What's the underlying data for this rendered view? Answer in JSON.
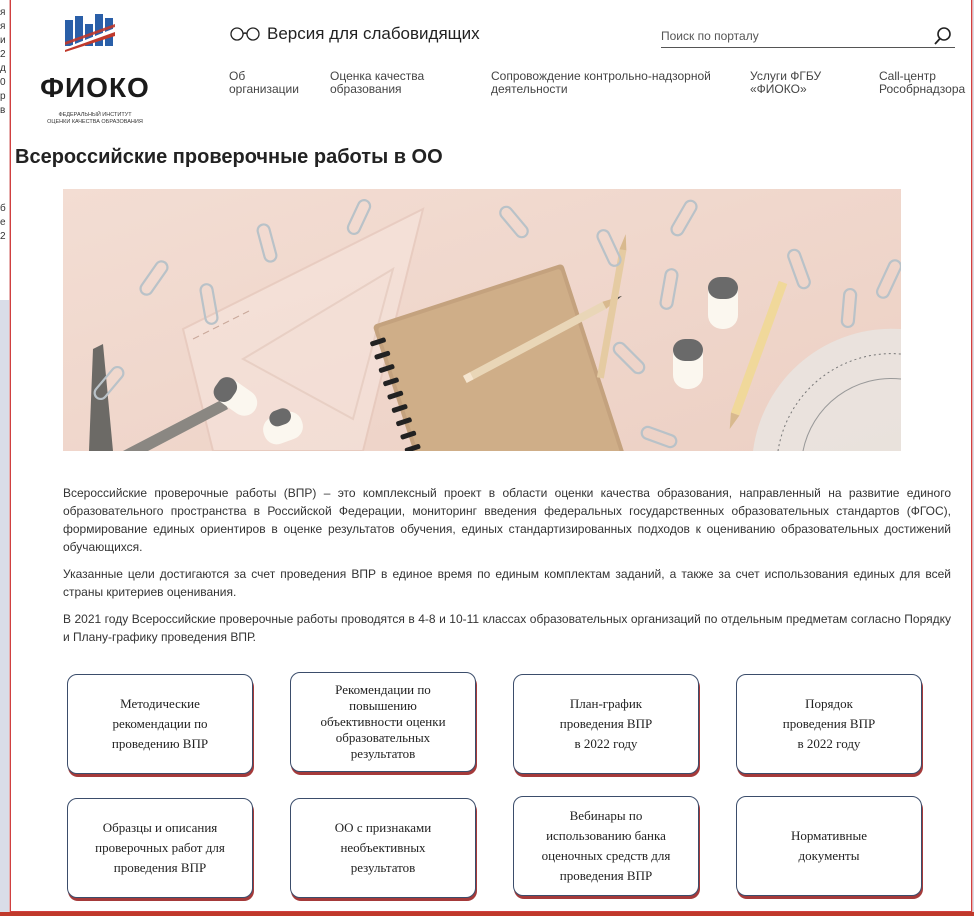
{
  "left_edge_chars": [
    "я",
    "я",
    "и",
    "2",
    "д",
    "0",
    "р",
    "в",
    "",
    "",
    "",
    "",
    "",
    "",
    "б",
    "е",
    "2"
  ],
  "logo": {
    "name": "ФИОКО",
    "subtitle_line1": "ФЕДЕРАЛЬНЫЙ ИНСТИТУТ",
    "subtitle_line2": "ОЦЕНКИ КАЧЕСТВА ОБРАЗОВАНИЯ"
  },
  "header": {
    "vision_label": "Версия для слабовидящих",
    "search_placeholder": "Поиск по порталу"
  },
  "nav": [
    {
      "line1": "Об",
      "line2": "организации"
    },
    {
      "line1": "Оценка качества",
      "line2": "образования"
    },
    {
      "line1": "Сопровождение контрольно-надзорной",
      "line2": "деятельности"
    },
    {
      "line1": "Услуги ФГБУ",
      "line2": "«ФИОКО»"
    },
    {
      "line1": "Call-центр",
      "line2": "Рособрнадзора"
    }
  ],
  "page_title": "Всероссийские проверочные работы в ОО",
  "article": {
    "p1": "Всероссийские проверочные работы (ВПР) – это комплексный проект в области оценки качества образования, направленный на развитие единого образовательного пространства в Российской Федерации, мониторинг введения федеральных государственных образовательных стандартов (ФГОС), формирование единых ориентиров в оценке результатов обучения, единых стандартизированных подходов к оцениванию образовательных достижений обучающихся.",
    "p2": "Указанные цели достигаются за счет проведения ВПР в единое время по единым комплектам заданий, а также за счет использования единых для всей страны критериев оценивания.",
    "p3": "В 2021 году Всероссийские проверочные работы проводятся в 4-8 и 10-11 классах образовательных организаций по отдельным предметам согласно Порядку и Плану-графику проведения ВПР."
  },
  "cards": [
    {
      "lines": [
        "Методические",
        "рекомендации по",
        "проведению ВПР"
      ]
    },
    {
      "lines": [
        "Рекомендации по",
        "повышению",
        "объективности оценки",
        "образовательных",
        "результатов"
      ]
    },
    {
      "lines": [
        "План-график",
        "проведения ВПР",
        "в 2022 году"
      ]
    },
    {
      "lines": [
        "Порядок",
        "проведения ВПР",
        "в 2022 году"
      ]
    },
    {
      "lines": [
        "Образцы и описания",
        "проверочных работ для",
        "проведения ВПР"
      ]
    },
    {
      "lines": [
        "ОО с признаками",
        "необъективных",
        "результатов"
      ]
    },
    {
      "lines": [
        "Вебинары по",
        "использованию банка",
        "оценочных средств для",
        "проведения ВПР"
      ]
    },
    {
      "lines": [
        "Нормативные",
        "документы"
      ]
    }
  ],
  "colors": {
    "brand_blue": "#2a5fa8",
    "brand_red": "#c0392b",
    "card_border": "#3b4d6b",
    "card_shadow": "#a53a3a",
    "hero_bg": "#f0d6cc"
  }
}
